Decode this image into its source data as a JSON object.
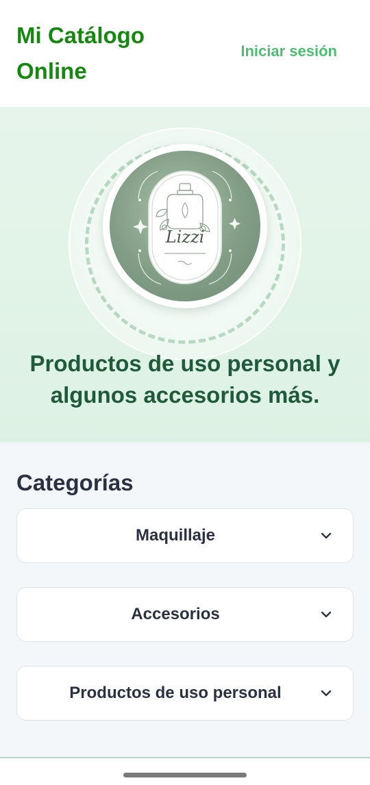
{
  "header": {
    "brand_line1": "Mi Catálogo",
    "brand_line2": "Online",
    "login_label": "Iniciar sesión"
  },
  "hero": {
    "logo_name": "Lizzi",
    "tagline": "Productos de uso personal y algunos accesorios más."
  },
  "categories": {
    "title": "Categorías",
    "items": [
      {
        "label": "Maquillaje",
        "icon": "chevron-down-icon"
      },
      {
        "label": "Accesorios",
        "icon": "chevron-down-icon"
      },
      {
        "label": "Productos de uso personal",
        "icon": "chevron-down-icon"
      }
    ]
  },
  "colors": {
    "brand": "#16870f",
    "login": "#4dbd74",
    "tagline": "#1f5a3a",
    "hero_bg": "#e2f3e8",
    "text_dark": "#2a3141"
  }
}
